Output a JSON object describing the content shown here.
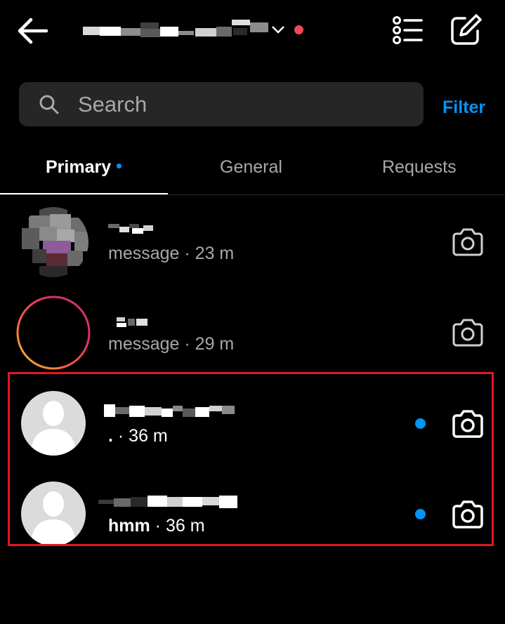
{
  "header": {
    "icons": {
      "back": "arrow-left-icon",
      "chevron": "chevron-down-icon",
      "list": "list-icon",
      "compose": "compose-icon"
    },
    "live_dot_color": "#ed4956"
  },
  "search": {
    "placeholder": "Search",
    "filter_label": "Filter"
  },
  "tabs": [
    {
      "label": "Primary",
      "active": true,
      "has_dot": true
    },
    {
      "label": "General",
      "active": false
    },
    {
      "label": "Requests",
      "active": false
    }
  ],
  "colors": {
    "accent": "#0095f6",
    "highlight": "#e5161f",
    "muted": "#a8a8a8"
  },
  "conversations": [
    {
      "preview": "message",
      "time": "23 m",
      "unread": false,
      "avatar": "pixelated-photo"
    },
    {
      "preview": "message",
      "time": "29 m",
      "unread": false,
      "avatar": "story-ring"
    },
    {
      "preview": ".",
      "time": "36 m",
      "unread": true,
      "avatar": "default-silhouette"
    },
    {
      "preview": "hmm",
      "time": "36 m",
      "unread": true,
      "avatar": "default-silhouette"
    }
  ]
}
